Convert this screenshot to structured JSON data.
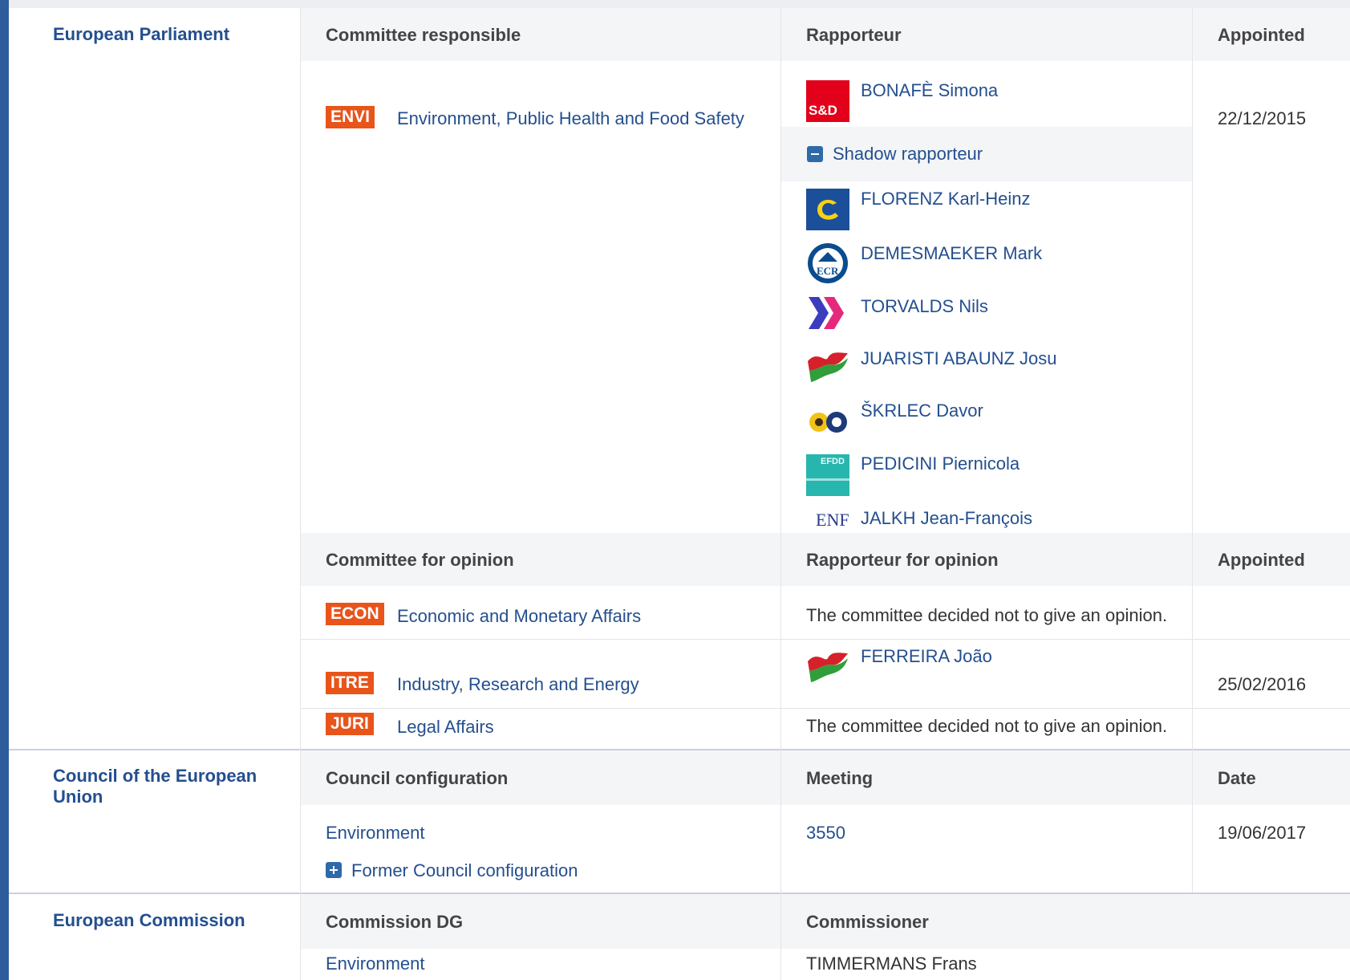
{
  "parliament": {
    "institution": "European Parliament",
    "headers": {
      "committee": "Committee responsible",
      "rapporteur": "Rapporteur",
      "appointed": "Appointed"
    },
    "responsible": {
      "badge": "ENVI",
      "name": "Environment, Public Health and Food Safety",
      "rapporteur": "BONAFÈ Simona",
      "appointed": "22/12/2015",
      "rapporteur_logo": "S&D"
    },
    "shadow_label": "Shadow rapporteur",
    "shadows": [
      {
        "name": "FLORENZ Karl-Heinz",
        "logo": "epp-icon"
      },
      {
        "name": "DEMESMAEKER Mark",
        "logo": "ecr-icon",
        "logo_text": "ECR"
      },
      {
        "name": "TORVALDS Nils",
        "logo": "alde-icon"
      },
      {
        "name": "JUARISTI ABAUNZ Josu",
        "logo": "gue-icon"
      },
      {
        "name": "ŠKRLEC Davor",
        "logo": "greens-icon"
      },
      {
        "name": "PEDICINI Piernicola",
        "logo": "efdd-icon",
        "logo_text": "EFDD"
      },
      {
        "name": "JALKH Jean-François",
        "logo": "enf-icon",
        "logo_text": "ENF"
      }
    ],
    "opinion_headers": {
      "committee": "Committee for opinion",
      "rapporteur": "Rapporteur for opinion",
      "appointed": "Appointed"
    },
    "opinions": [
      {
        "badge": "ECON",
        "name": "Economic and Monetary Affairs",
        "rapporteur": "The committee decided not to give an opinion.",
        "appointed": ""
      },
      {
        "badge": "ITRE",
        "name": "Industry, Research and Energy",
        "rapporteur": "FERREIRA João",
        "appointed": "25/02/2016"
      },
      {
        "badge": "JURI",
        "name": "Legal Affairs",
        "rapporteur": "The committee decided not to give an opinion.",
        "appointed": ""
      }
    ]
  },
  "council": {
    "institution": "Council of the European Union",
    "headers": {
      "configuration": "Council configuration",
      "meeting": "Meeting",
      "date": "Date"
    },
    "configuration": "Environment",
    "meeting": "3550",
    "date": "19/06/2017",
    "former_label": "Former Council configuration"
  },
  "commission": {
    "institution": "European Commission",
    "headers": {
      "dg": "Commission DG",
      "commissioner": "Commissioner"
    },
    "dg": "Environment",
    "commissioner": "TIMMERMANS Frans"
  }
}
